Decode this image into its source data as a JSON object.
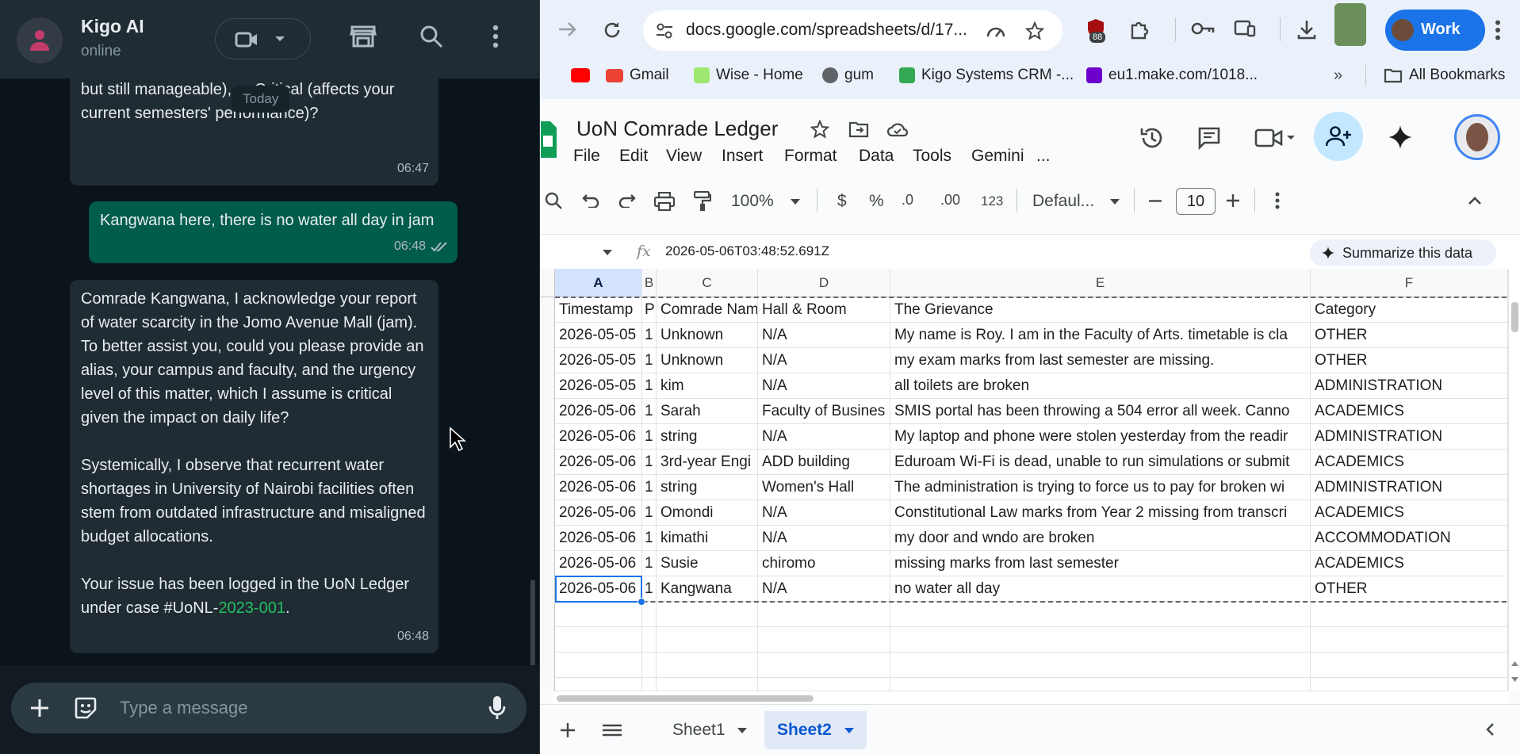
{
  "whatsapp": {
    "chat_name": "Kigo AI",
    "status": "online",
    "today_label": "Today",
    "messages": [
      {
        "direction": "in",
        "partial_top": "wait for a while), Medium (some inconvenience but still manageable), or Critical (affects your current semesters' performance)?",
        "time": "06:47"
      },
      {
        "direction": "out",
        "text": "Kangwana here, there is no water all day in jam",
        "time": "06:48",
        "status": "read"
      },
      {
        "direction": "in",
        "text_p1": "Comrade Kangwana, I acknowledge your report of water scarcity in the Jomo Avenue Mall (jam). To better assist you, could you please provide an alias, your campus and faculty, and the urgency level of this matter, which I assume is critical given the impact on daily life?",
        "text_p2": "Systemically, I observe that recurrent water shortages in University of Nairobi facilities often stem from outdated infrastructure and misaligned budget allocations.",
        "text_p3_before": "Your issue has been logged in the UoN Ledger under case #UoNL-",
        "text_p3_link": "2023-001",
        "text_p3_after": ".",
        "time": "06:48"
      }
    ],
    "input_placeholder": "Type a message"
  },
  "browser": {
    "url": "docs.google.com/spreadsheets/d/17...",
    "extension_badge": "88",
    "profile_label": "Work",
    "bookmarks": [
      {
        "label": "",
        "icon": "youtube-icon",
        "color": "#ff0000"
      },
      {
        "label": "Gmail",
        "icon": "gmail-icon",
        "color": "#ea4335"
      },
      {
        "label": "Wise - Home",
        "icon": "wise-icon",
        "color": "#9fe870"
      },
      {
        "label": "gum",
        "icon": "globe-icon",
        "color": "#5f6368"
      },
      {
        "label": "Kigo Systems CRM -...",
        "icon": "crm-icon",
        "color": "#34a853"
      },
      {
        "label": "eu1.make.com/1018...",
        "icon": "make-icon",
        "color": "#6d00cc"
      }
    ],
    "all_bookmarks_label": "All Bookmarks"
  },
  "sheets": {
    "title": "UoN Comrade Ledger",
    "menu": [
      "File",
      "Edit",
      "View",
      "Insert",
      "Format",
      "Data",
      "Tools",
      "Gemini",
      "..."
    ],
    "zoom": "100%",
    "currency_symbol": "$",
    "percent_symbol": "%",
    "dec_decrease": ".0",
    "dec_increase": ".00",
    "number_format": "123",
    "font_name": "Defaul...",
    "font_size": "10",
    "formula_value": "2026-05-06T03:48:52.691Z",
    "summarize_label": "Summarize this data",
    "column_letters": [
      "A",
      "B",
      "C",
      "D",
      "E",
      "F"
    ],
    "rows": [
      [
        "Timestamp",
        "P",
        "Comrade Nam",
        "Hall & Room",
        "The Grievance",
        "Category"
      ],
      [
        "2026-05-05",
        "1",
        "Unknown",
        "N/A",
        "My name is Roy. I am in the Faculty of Arts. timetable is cla",
        "OTHER"
      ],
      [
        "2026-05-05",
        "1",
        "Unknown",
        "N/A",
        "my exam marks from last semester are missing.",
        "OTHER"
      ],
      [
        "2026-05-05",
        "1",
        "kim",
        "N/A",
        "all toilets are broken",
        "ADMINISTRATION"
      ],
      [
        "2026-05-06",
        "1",
        "Sarah",
        "Faculty of Busines",
        "SMIS portal has been throwing a 504 error all week. Canno",
        "ACADEMICS"
      ],
      [
        "2026-05-06",
        "1",
        "string",
        "N/A",
        "My laptop and phone were stolen yesterday from the readir",
        "ADMINISTRATION"
      ],
      [
        "2026-05-06",
        "1",
        "3rd-year Engi",
        "ADD building",
        "Eduroam Wi-Fi is dead, unable to run simulations or submit",
        "ACADEMICS"
      ],
      [
        "2026-05-06",
        "1",
        "string",
        "Women's Hall",
        "The administration is trying to force us to pay for broken wi",
        "ADMINISTRATION"
      ],
      [
        "2026-05-06",
        "1",
        "Omondi",
        "N/A",
        "Constitutional Law marks from Year 2 missing from transcri",
        "ACADEMICS"
      ],
      [
        "2026-05-06",
        "1",
        "kimathi",
        "N/A",
        "my door and wndo are broken",
        "ACCOMMODATION"
      ],
      [
        "2026-05-06",
        "1",
        "Susie",
        "chiromo",
        "missing marks from last semester",
        "ACADEMICS"
      ],
      [
        "2026-05-06",
        "1",
        "Kangwana",
        "N/A",
        "no water all day",
        "OTHER"
      ]
    ],
    "tabs": [
      {
        "label": "Sheet1",
        "active": false
      },
      {
        "label": "Sheet2",
        "active": true
      }
    ]
  }
}
